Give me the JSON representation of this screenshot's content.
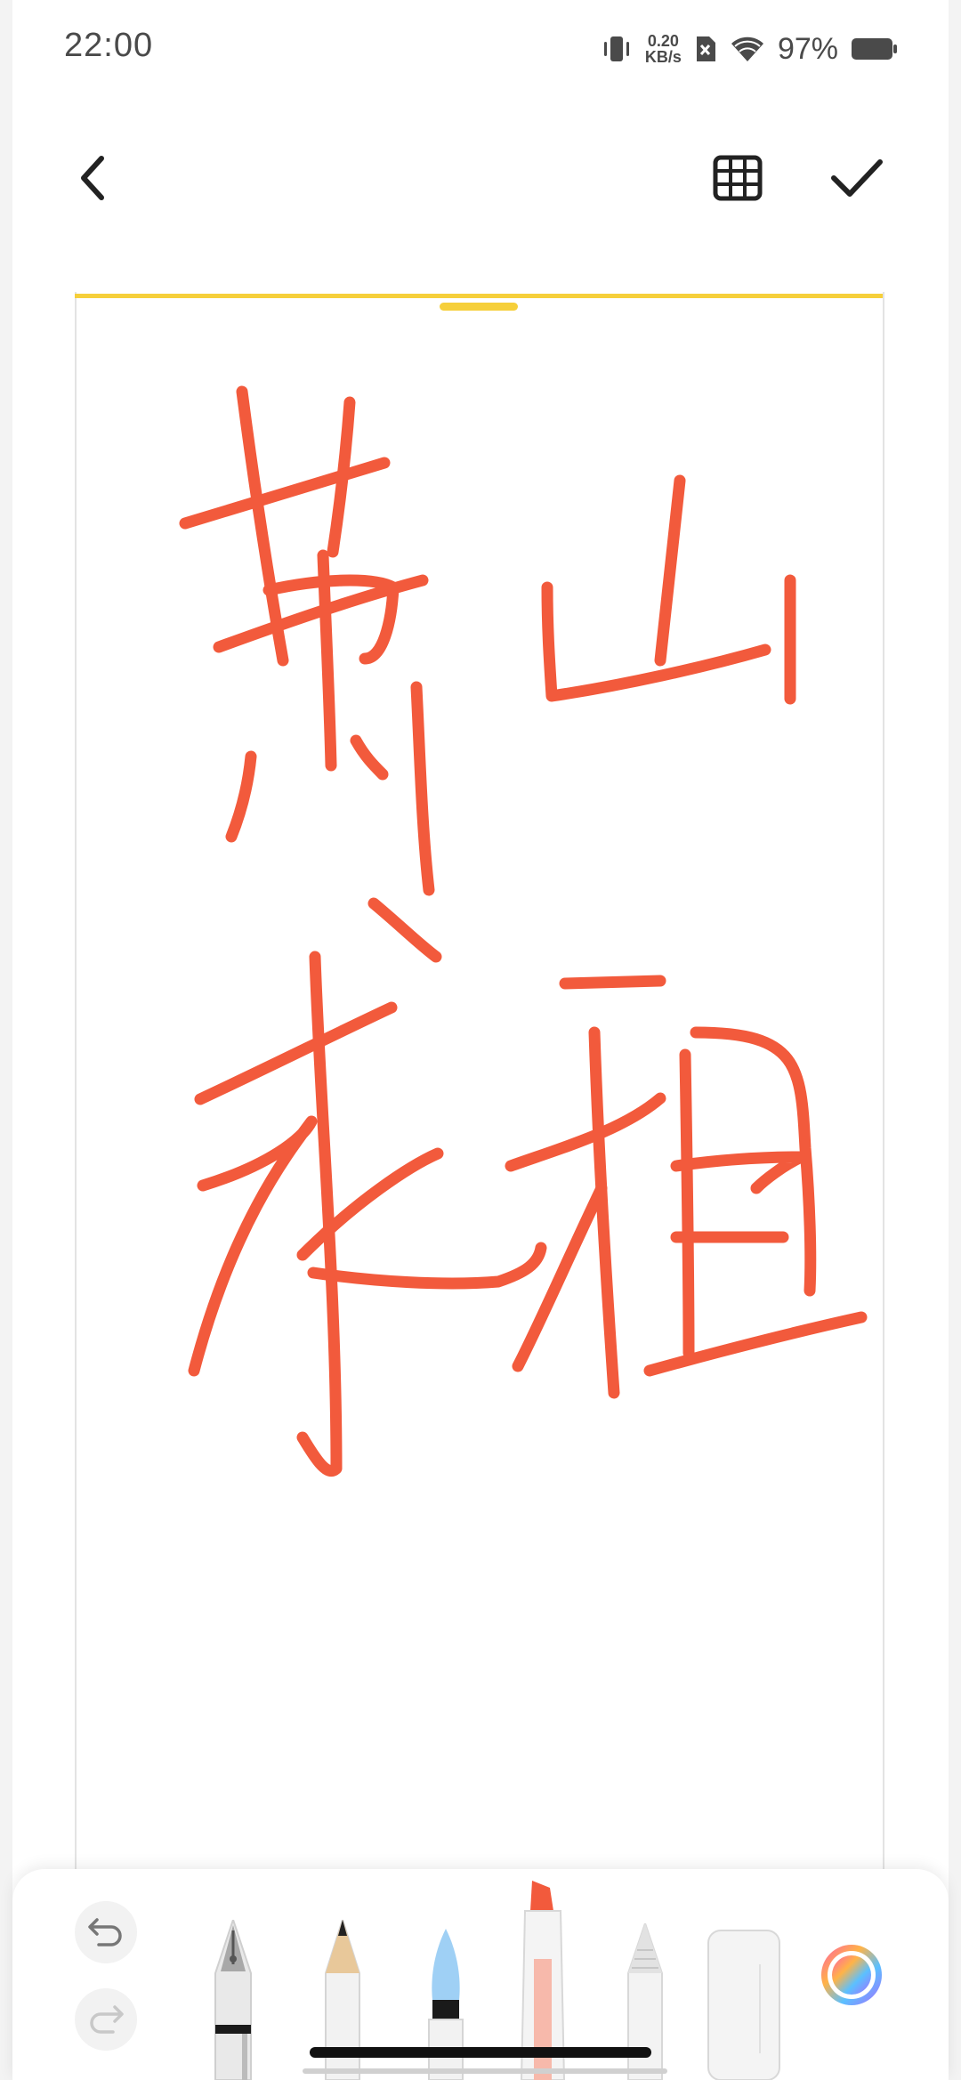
{
  "status": {
    "time": "22:00",
    "net_speed_value": "0.20",
    "net_speed_unit": "KB/s",
    "battery": "97%"
  },
  "toolbar": {
    "back_icon": "chevron-left-icon",
    "grid_icon": "grid-icon",
    "confirm_icon": "check-icon"
  },
  "canvas": {
    "accent_color": "#f6cf3a",
    "ink_color": "#f25a3c"
  },
  "tools": {
    "items": [
      "fountain-pen",
      "pencil",
      "watercolor-brush",
      "marker",
      "crayon",
      "eraser",
      "color-picker"
    ],
    "selected": "marker"
  }
}
